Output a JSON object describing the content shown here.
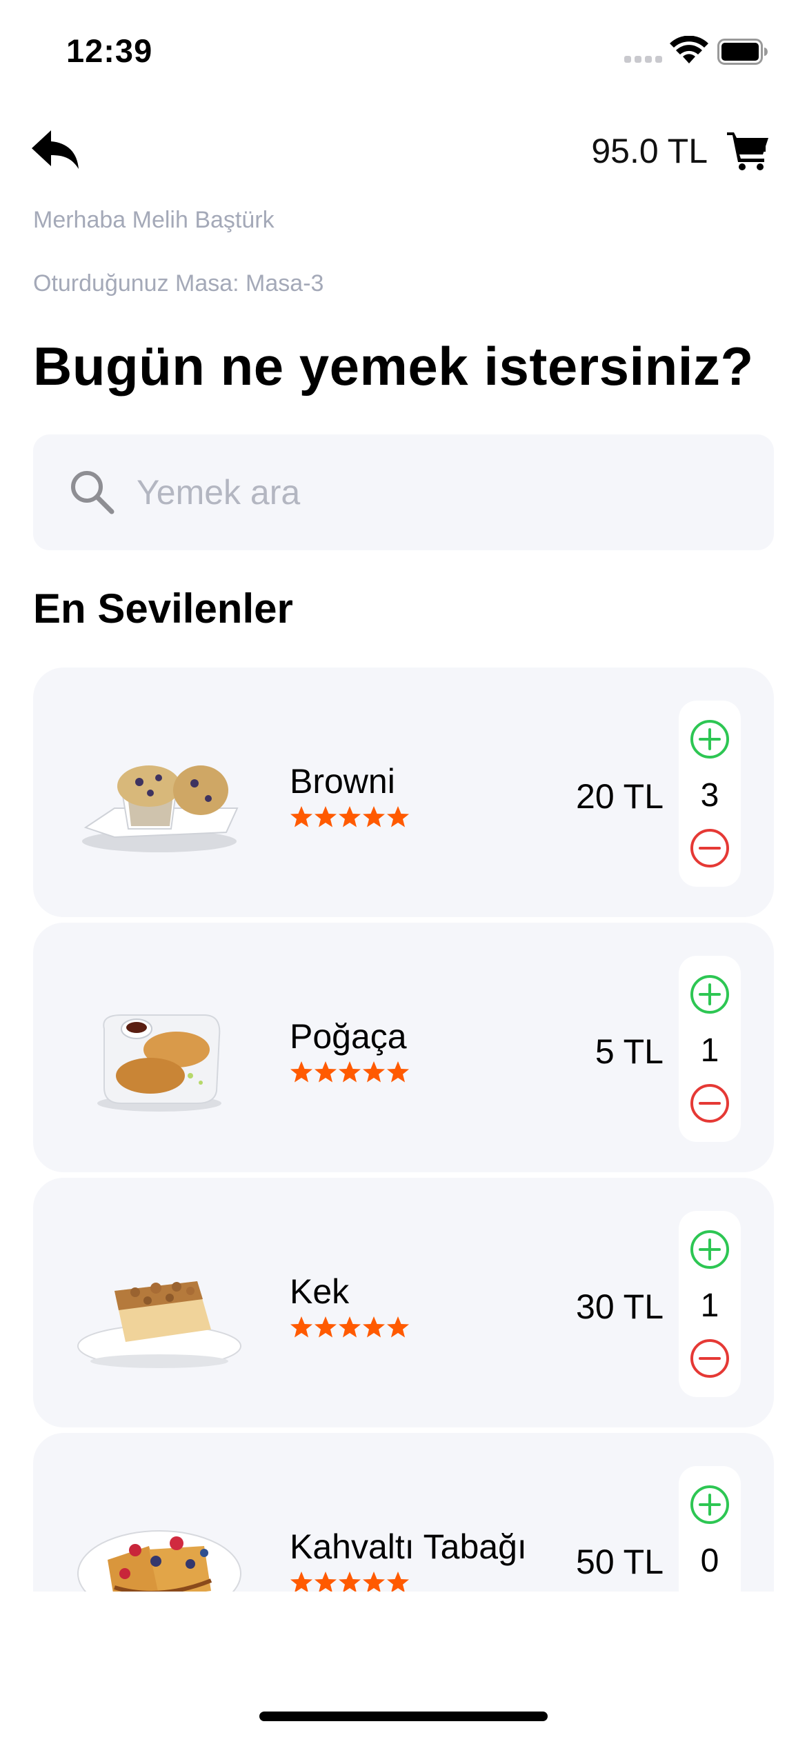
{
  "status_bar": {
    "time": "12:39"
  },
  "header": {
    "cart_total": "95.0 TL"
  },
  "greeting": "Merhaba Melih Baştürk",
  "table_info": "Oturduğunuz Masa: Masa-3",
  "headline": "Bugün ne yemek istersiniz?",
  "search": {
    "placeholder": "Yemek ara",
    "value": ""
  },
  "section_title": "En Sevilenler",
  "items": [
    {
      "name": "Browni",
      "price": "20 TL",
      "quantity": "3",
      "rating": 5,
      "image": "muffin-plate"
    },
    {
      "name": "Poğaça",
      "price": "5 TL",
      "quantity": "1",
      "rating": 5,
      "image": "pastry-plate"
    },
    {
      "name": "Kek",
      "price": "30 TL",
      "quantity": "1",
      "rating": 5,
      "image": "crumb-cake-plate"
    },
    {
      "name": "Kahvaltı Tabağı",
      "price": "50 TL",
      "quantity": "0",
      "rating": 5,
      "image": "french-toast-plate"
    }
  ],
  "colors": {
    "star": "#ff5a00",
    "plus": "#2dc653",
    "minus": "#e53935",
    "card_bg": "#f5f6fa",
    "muted_text": "#a4a9b8"
  }
}
